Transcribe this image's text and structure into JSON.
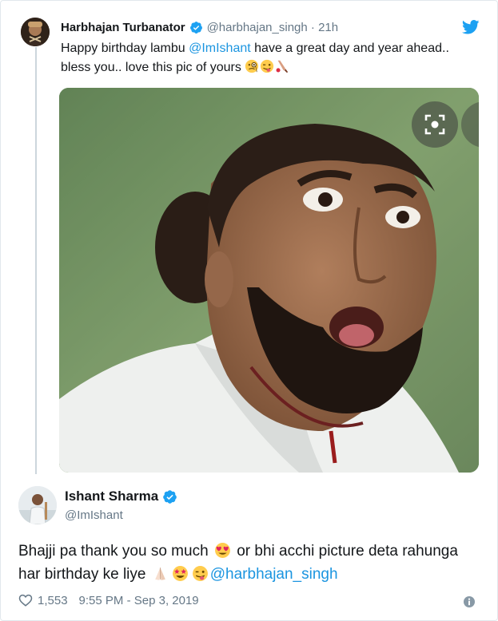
{
  "quoted_tweet": {
    "name": "Harbhajan Turbanator",
    "handle": "@harbhajan_singh",
    "separator": "·",
    "time": "21h",
    "text_part1": "Happy birthday lambu ",
    "mention": "@ImIshant",
    "text_part2": " have a great day and year ahead.. bless you.. love this pic of yours ",
    "emojis": [
      "monocle-face-emoji",
      "winking-tongue-emoji",
      "cricket-bat-emoji"
    ]
  },
  "tweet": {
    "name": "Ishant Sharma",
    "handle": "@ImIshant",
    "text_part1": "Bhajji pa thank you so much ",
    "text_part2": " or bhi acchi picture deta rahunga har birthday ke liye ",
    "mention": "@harbhajan_singh",
    "likes": "1,553",
    "timestamp": "9:55 PM - Sep 3, 2019"
  },
  "colors": {
    "link": "#1b95e0",
    "verified": "#1da1f2",
    "secondary_text": "#657786",
    "thread_line": "#ccd6dd"
  },
  "icons": [
    "twitter-bird-icon",
    "verified-badge-icon",
    "scan-image-icon",
    "heart-icon",
    "info-icon"
  ]
}
